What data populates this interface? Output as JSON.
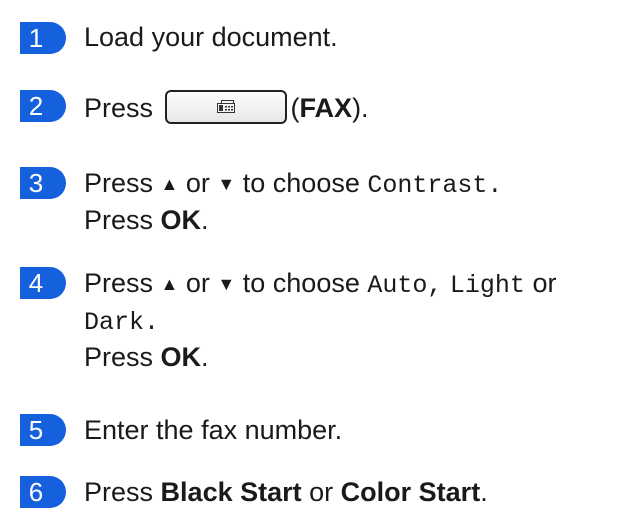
{
  "steps": [
    {
      "number": "1",
      "text": "Load your document."
    },
    {
      "number": "2",
      "press": "Press",
      "open": "(",
      "key": "FAX",
      "close": ")."
    },
    {
      "number": "3",
      "press": "Press",
      "up": "▲",
      "or": "or",
      "down": "▼",
      "to_choose": "to choose",
      "option": "Contrast",
      "end": ".",
      "press2": "Press",
      "ok": "OK",
      "end2": "."
    },
    {
      "number": "4",
      "press": "Press",
      "up": "▲",
      "or": "or",
      "down": "▼",
      "to_choose": "to choose",
      "opt1": "Auto",
      "comma1": ",",
      "opt2": "Light",
      "or2": "or",
      "opt3": "Dark",
      "end": ".",
      "press2": "Press",
      "ok": "OK",
      "end2": "."
    },
    {
      "number": "5",
      "text": "Enter the fax number."
    },
    {
      "number": "6",
      "press": "Press",
      "key1": "Black Start",
      "or": "or",
      "key2": "Color Start",
      "end": "."
    }
  ],
  "icons": {
    "fax_button": "fax-icon"
  },
  "colors": {
    "step_badge": "#1560dd"
  }
}
